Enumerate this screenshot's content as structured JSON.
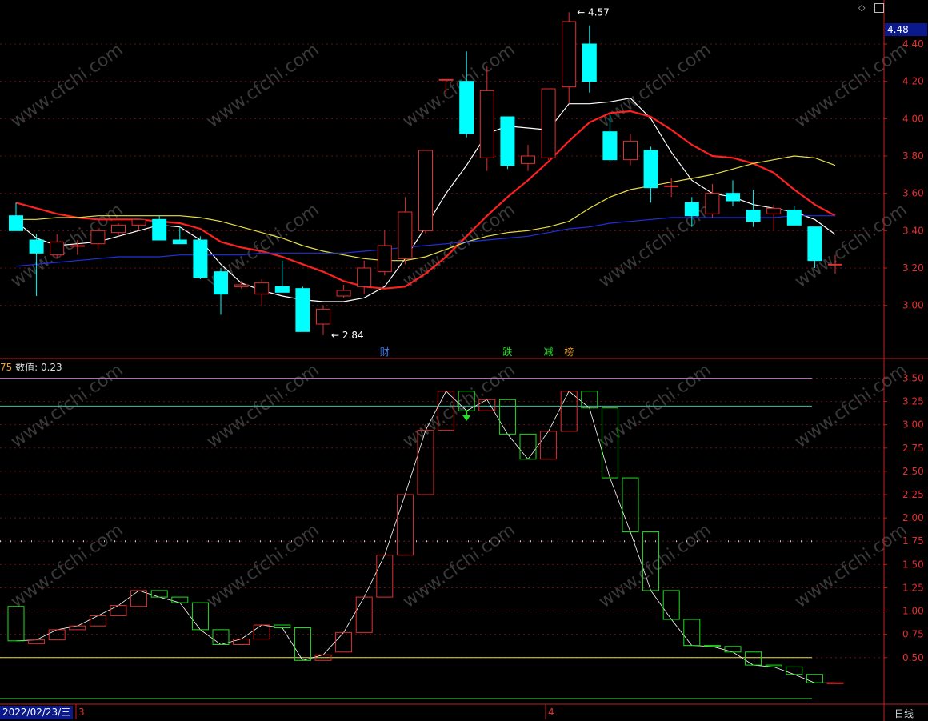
{
  "header": {
    "icons": [
      "diamond-icon",
      "panel-icon"
    ],
    "current_price": "4.48"
  },
  "indicator_header": {
    "code": "75",
    "label": "数值: 0.23"
  },
  "footer": {
    "date": "2022/02/23/三",
    "month_marks": [
      "3",
      "4"
    ],
    "period": "日线"
  },
  "colors": {
    "up": "#e03030",
    "down": "#00ffff",
    "ma5": "#ffffff",
    "ma10": "#ff2020",
    "ma20": "#e8e040",
    "ma60": "#2030e0",
    "ind_up": "#e03030",
    "ind_down": "#20e020"
  },
  "events": [
    {
      "label": "财",
      "index": 18,
      "color": "#4080ff"
    },
    {
      "label": "跌",
      "index": 24,
      "color": "#20e020"
    },
    {
      "label": "减",
      "index": 26,
      "color": "#20e020"
    },
    {
      "label": "榜",
      "index": 27,
      "color": "#e8a030"
    }
  ],
  "chart_data": [
    {
      "type": "candlestick",
      "ylim": [
        2.75,
        4.55
      ],
      "yticks": [
        "4.40",
        "4.20",
        "4.00",
        "3.80",
        "3.60",
        "3.40",
        "3.20",
        "3.00"
      ],
      "annotations": [
        {
          "text": "4.57",
          "index": 27,
          "value": 4.57
        },
        {
          "text": "2.84",
          "index": 15,
          "value": 2.84
        }
      ],
      "candles": [
        {
          "o": 3.48,
          "h": 3.55,
          "l": 3.4,
          "c": 3.4
        },
        {
          "o": 3.35,
          "h": 3.38,
          "l": 3.05,
          "c": 3.28
        },
        {
          "o": 3.27,
          "h": 3.38,
          "l": 3.25,
          "c": 3.34
        },
        {
          "o": 3.32,
          "h": 3.35,
          "l": 3.27,
          "c": 3.32
        },
        {
          "o": 3.33,
          "h": 3.42,
          "l": 3.3,
          "c": 3.4
        },
        {
          "o": 3.39,
          "h": 3.44,
          "l": 3.37,
          "c": 3.43
        },
        {
          "o": 3.43,
          "h": 3.46,
          "l": 3.4,
          "c": 3.46
        },
        {
          "o": 3.46,
          "h": 3.48,
          "l": 3.35,
          "c": 3.35
        },
        {
          "o": 3.35,
          "h": 3.42,
          "l": 3.33,
          "c": 3.33
        },
        {
          "o": 3.35,
          "h": 3.37,
          "l": 3.14,
          "c": 3.15
        },
        {
          "o": 3.18,
          "h": 3.2,
          "l": 2.95,
          "c": 3.06
        },
        {
          "o": 3.1,
          "h": 3.13,
          "l": 3.09,
          "c": 3.11
        },
        {
          "o": 3.06,
          "h": 3.14,
          "l": 3.0,
          "c": 3.12
        },
        {
          "o": 3.1,
          "h": 3.24,
          "l": 3.07,
          "c": 3.07
        },
        {
          "o": 3.09,
          "h": 3.1,
          "l": 2.86,
          "c": 2.86
        },
        {
          "o": 2.9,
          "h": 3.0,
          "l": 2.84,
          "c": 2.98
        },
        {
          "o": 3.05,
          "h": 3.11,
          "l": 3.04,
          "c": 3.08
        },
        {
          "o": 3.1,
          "h": 3.24,
          "l": 3.06,
          "c": 3.2
        },
        {
          "o": 3.18,
          "h": 3.4,
          "l": 3.16,
          "c": 3.32
        },
        {
          "o": 3.25,
          "h": 3.58,
          "l": 3.22,
          "c": 3.5
        },
        {
          "o": 3.4,
          "h": 3.83,
          "l": 3.38,
          "c": 3.83
        },
        {
          "o": 4.21,
          "h": 4.21,
          "l": 4.13,
          "c": 4.21
        },
        {
          "o": 4.2,
          "h": 4.36,
          "l": 3.9,
          "c": 3.92
        },
        {
          "o": 3.79,
          "h": 4.28,
          "l": 3.72,
          "c": 4.15
        },
        {
          "o": 4.01,
          "h": 4.01,
          "l": 3.73,
          "c": 3.75
        },
        {
          "o": 3.76,
          "h": 3.86,
          "l": 3.72,
          "c": 3.8
        },
        {
          "o": 3.79,
          "h": 4.16,
          "l": 3.78,
          "c": 4.16
        },
        {
          "o": 4.17,
          "h": 4.57,
          "l": 4.08,
          "c": 4.52
        },
        {
          "o": 4.4,
          "h": 4.5,
          "l": 4.14,
          "c": 4.2
        },
        {
          "o": 3.93,
          "h": 4.02,
          "l": 3.77,
          "c": 3.78
        },
        {
          "o": 3.78,
          "h": 3.92,
          "l": 3.75,
          "c": 3.88
        },
        {
          "o": 3.83,
          "h": 3.85,
          "l": 3.55,
          "c": 3.63
        },
        {
          "o": 3.64,
          "h": 3.68,
          "l": 3.58,
          "c": 3.64
        },
        {
          "o": 3.55,
          "h": 3.58,
          "l": 3.42,
          "c": 3.48
        },
        {
          "o": 3.49,
          "h": 3.65,
          "l": 3.47,
          "c": 3.6
        },
        {
          "o": 3.6,
          "h": 3.67,
          "l": 3.53,
          "c": 3.56
        },
        {
          "o": 3.51,
          "h": 3.62,
          "l": 3.42,
          "c": 3.45
        },
        {
          "o": 3.49,
          "h": 3.54,
          "l": 3.4,
          "c": 3.52
        },
        {
          "o": 3.51,
          "h": 3.53,
          "l": 3.43,
          "c": 3.43
        },
        {
          "o": 3.42,
          "h": 3.42,
          "l": 3.2,
          "c": 3.24
        },
        {
          "o": 3.22,
          "h": 3.27,
          "l": 3.17,
          "c": 3.22
        }
      ],
      "series": [
        {
          "key": "ma5",
          "values": [
            3.45,
            3.36,
            3.32,
            3.33,
            3.34,
            3.37,
            3.4,
            3.43,
            3.42,
            3.35,
            3.22,
            3.12,
            3.08,
            3.05,
            3.03,
            3.02,
            3.02,
            3.04,
            3.1,
            3.25,
            3.42,
            3.6,
            3.75,
            3.92,
            3.96,
            3.95,
            3.94,
            4.08,
            4.08,
            4.09,
            4.11,
            4.0,
            3.82,
            3.67,
            3.6,
            3.58,
            3.54,
            3.52,
            3.5,
            3.46,
            3.38
          ]
        },
        {
          "key": "ma10",
          "values": [
            3.55,
            3.52,
            3.49,
            3.47,
            3.46,
            3.46,
            3.46,
            3.45,
            3.44,
            3.41,
            3.34,
            3.31,
            3.29,
            3.26,
            3.22,
            3.18,
            3.13,
            3.1,
            3.09,
            3.1,
            3.17,
            3.26,
            3.37,
            3.48,
            3.58,
            3.67,
            3.77,
            3.88,
            3.98,
            4.03,
            4.04,
            4.01,
            3.94,
            3.86,
            3.8,
            3.79,
            3.76,
            3.71,
            3.62,
            3.54,
            3.48
          ]
        },
        {
          "key": "ma20",
          "values": [
            3.46,
            3.46,
            3.47,
            3.47,
            3.48,
            3.48,
            3.48,
            3.48,
            3.48,
            3.47,
            3.45,
            3.42,
            3.39,
            3.36,
            3.32,
            3.29,
            3.27,
            3.25,
            3.24,
            3.24,
            3.26,
            3.3,
            3.34,
            3.37,
            3.39,
            3.4,
            3.42,
            3.45,
            3.52,
            3.58,
            3.62,
            3.64,
            3.66,
            3.68,
            3.7,
            3.73,
            3.76,
            3.78,
            3.8,
            3.79,
            3.75
          ]
        },
        {
          "key": "ma60",
          "values": [
            3.21,
            3.22,
            3.23,
            3.24,
            3.25,
            3.26,
            3.26,
            3.26,
            3.27,
            3.27,
            3.27,
            3.27,
            3.28,
            3.28,
            3.28,
            3.28,
            3.28,
            3.29,
            3.3,
            3.31,
            3.32,
            3.33,
            3.34,
            3.35,
            3.36,
            3.37,
            3.39,
            3.41,
            3.42,
            3.44,
            3.45,
            3.46,
            3.47,
            3.47,
            3.47,
            3.47,
            3.47,
            3.47,
            3.48,
            3.48,
            3.48
          ]
        }
      ]
    },
    {
      "type": "indicator",
      "ylim": [
        0.0,
        3.65
      ],
      "yticks": [
        "3.50",
        "3.25",
        "3.00",
        "2.75",
        "2.50",
        "2.25",
        "2.00",
        "1.75",
        "1.50",
        "1.25",
        "1.00",
        "0.75",
        "0.50"
      ],
      "reference_lines": [
        {
          "value": 3.5,
          "color": "#c060c0"
        },
        {
          "value": 3.2,
          "color": "#40c0a0"
        },
        {
          "value": 1.75,
          "color": "#cccccc",
          "style": "dotted"
        },
        {
          "value": 0.5,
          "color": "#e8e040"
        },
        {
          "value": 0.06,
          "color": "#40e040"
        }
      ],
      "signal": {
        "index": 22,
        "value": 3.1,
        "color": "#20e020"
      },
      "boxes": [
        {
          "o": 1.05,
          "c": 0.68
        },
        {
          "o": 0.65,
          "c": 0.69
        },
        {
          "o": 0.69,
          "c": 0.8
        },
        {
          "o": 0.8,
          "c": 0.84
        },
        {
          "o": 0.84,
          "c": 0.95
        },
        {
          "o": 0.95,
          "c": 1.06
        },
        {
          "o": 1.05,
          "c": 1.22
        },
        {
          "o": 1.22,
          "c": 1.15
        },
        {
          "o": 1.15,
          "c": 1.09
        },
        {
          "o": 1.09,
          "c": 0.8
        },
        {
          "o": 0.8,
          "c": 0.64
        },
        {
          "o": 0.64,
          "c": 0.7
        },
        {
          "o": 0.7,
          "c": 0.85
        },
        {
          "o": 0.85,
          "c": 0.82
        },
        {
          "o": 0.82,
          "c": 0.47
        },
        {
          "o": 0.47,
          "c": 0.53
        },
        {
          "o": 0.56,
          "c": 0.77
        },
        {
          "o": 0.77,
          "c": 1.15
        },
        {
          "o": 1.15,
          "c": 1.6
        },
        {
          "o": 1.6,
          "c": 2.25
        },
        {
          "o": 2.25,
          "c": 2.94
        },
        {
          "o": 2.94,
          "c": 3.36
        },
        {
          "o": 3.36,
          "c": 3.15
        },
        {
          "o": 3.15,
          "c": 3.27
        },
        {
          "o": 3.27,
          "c": 2.9
        },
        {
          "o": 2.9,
          "c": 2.63
        },
        {
          "o": 2.63,
          "c": 2.93
        },
        {
          "o": 2.93,
          "c": 3.36
        },
        {
          "o": 3.36,
          "c": 3.18
        },
        {
          "o": 3.18,
          "c": 2.43
        },
        {
          "o": 2.43,
          "c": 1.85
        },
        {
          "o": 1.85,
          "c": 1.22
        },
        {
          "o": 1.22,
          "c": 0.91
        },
        {
          "o": 0.91,
          "c": 0.63
        },
        {
          "o": 0.63,
          "c": 0.62
        },
        {
          "o": 0.62,
          "c": 0.56
        },
        {
          "o": 0.56,
          "c": 0.42
        },
        {
          "o": 0.42,
          "c": 0.4
        },
        {
          "o": 0.4,
          "c": 0.32
        },
        {
          "o": 0.32,
          "c": 0.23
        },
        {
          "o": 0.23,
          "c": 0.23
        }
      ]
    }
  ]
}
